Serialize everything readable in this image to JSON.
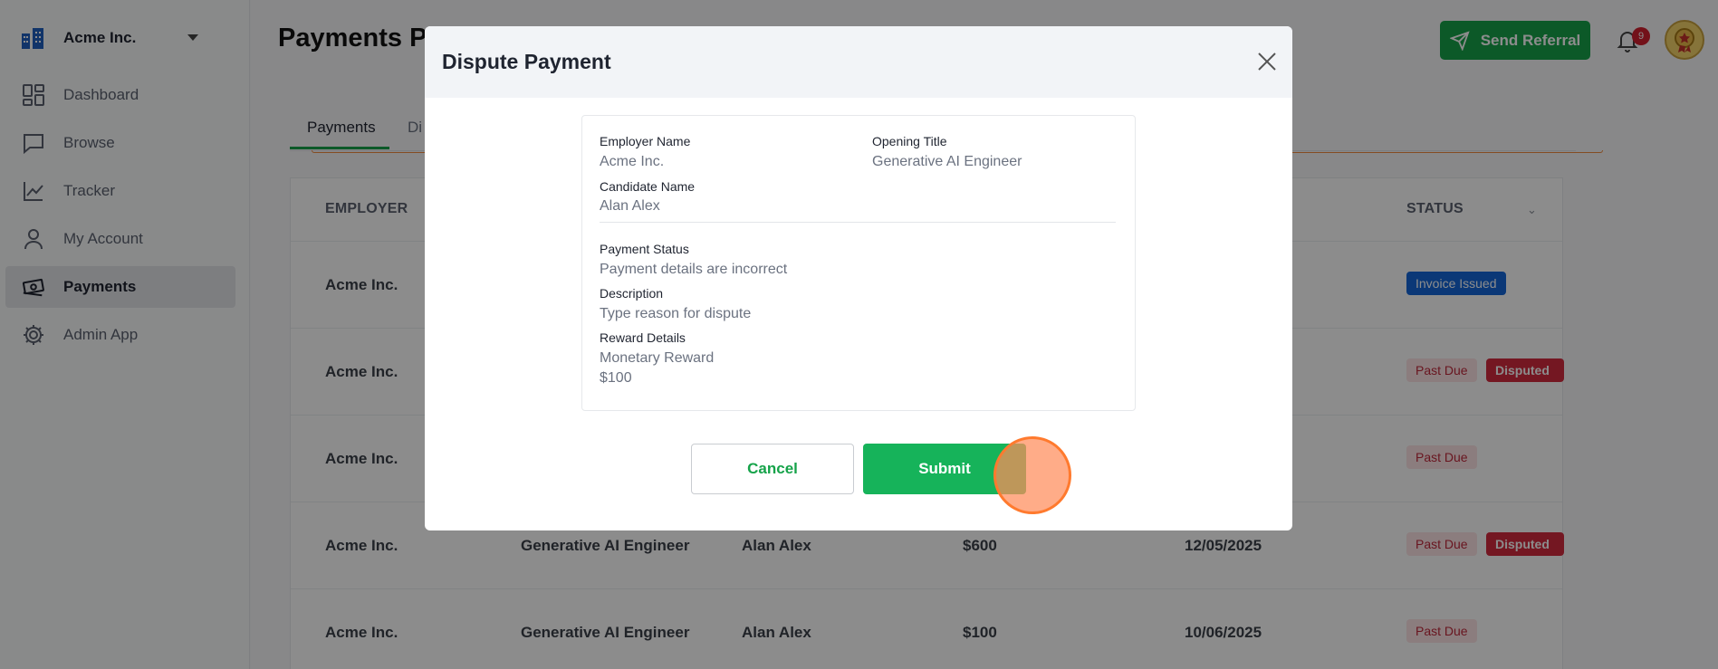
{
  "brand": {
    "name": "Acme Inc."
  },
  "sidebar": {
    "items": [
      {
        "label": "Dashboard",
        "icon": "dashboard-icon"
      },
      {
        "label": "Browse",
        "icon": "chat-icon"
      },
      {
        "label": "Tracker",
        "icon": "chart-line-icon"
      },
      {
        "label": "My Account",
        "icon": "user-icon"
      },
      {
        "label": "Payments",
        "icon": "money-icon",
        "active": true
      },
      {
        "label": "Admin App",
        "icon": "gear-icon"
      }
    ]
  },
  "header": {
    "title": "Payments Po",
    "referral_label": "Send Referral",
    "notification_count": "9"
  },
  "tabs": [
    {
      "label": "Payments"
    },
    {
      "label": "Di"
    }
  ],
  "table": {
    "columns": {
      "employer": "EMPLOYER",
      "status": "STATUS"
    },
    "rows": [
      {
        "employer": "Acme Inc.",
        "opening": "",
        "candidate": "",
        "amount": "",
        "date": "",
        "statuses": [
          "Invoice Issued"
        ]
      },
      {
        "employer": "Acme Inc.",
        "opening": "",
        "candidate": "",
        "amount": "",
        "date": "",
        "statuses": [
          "Past Due",
          "Disputed"
        ]
      },
      {
        "employer": "Acme Inc.",
        "opening": "",
        "candidate": "",
        "amount": "",
        "date": "",
        "statuses": [
          "Past Due"
        ]
      },
      {
        "employer": "Acme Inc.",
        "opening": "Generative AI Engineer",
        "candidate": "Alan Alex",
        "amount": "$600",
        "date": "12/05/2025",
        "statuses": [
          "Past Due",
          "Disputed"
        ]
      },
      {
        "employer": "Acme Inc.",
        "opening": "Generative AI Engineer",
        "candidate": "Alan Alex",
        "amount": "$100",
        "date": "10/06/2025",
        "statuses": [
          "Past Due"
        ]
      }
    ]
  },
  "modal": {
    "title": "Dispute Payment",
    "employer_label": "Employer Name",
    "employer_value": "Acme Inc.",
    "opening_label": "Opening Title",
    "opening_value": "Generative AI Engineer",
    "candidate_label": "Candidate Name",
    "candidate_value": "Alan Alex",
    "status_label": "Payment Status",
    "status_value": "Payment details are incorrect",
    "description_label": "Description",
    "description_placeholder": "Type reason for dispute",
    "reward_label": "Reward Details",
    "reward_type": "Monetary Reward",
    "reward_amount": "$100",
    "cancel_label": "Cancel",
    "submit_label": "Submit"
  },
  "colors": {
    "accent": "#16a34a",
    "danger": "#d42a3e",
    "info": "#1467d9"
  }
}
